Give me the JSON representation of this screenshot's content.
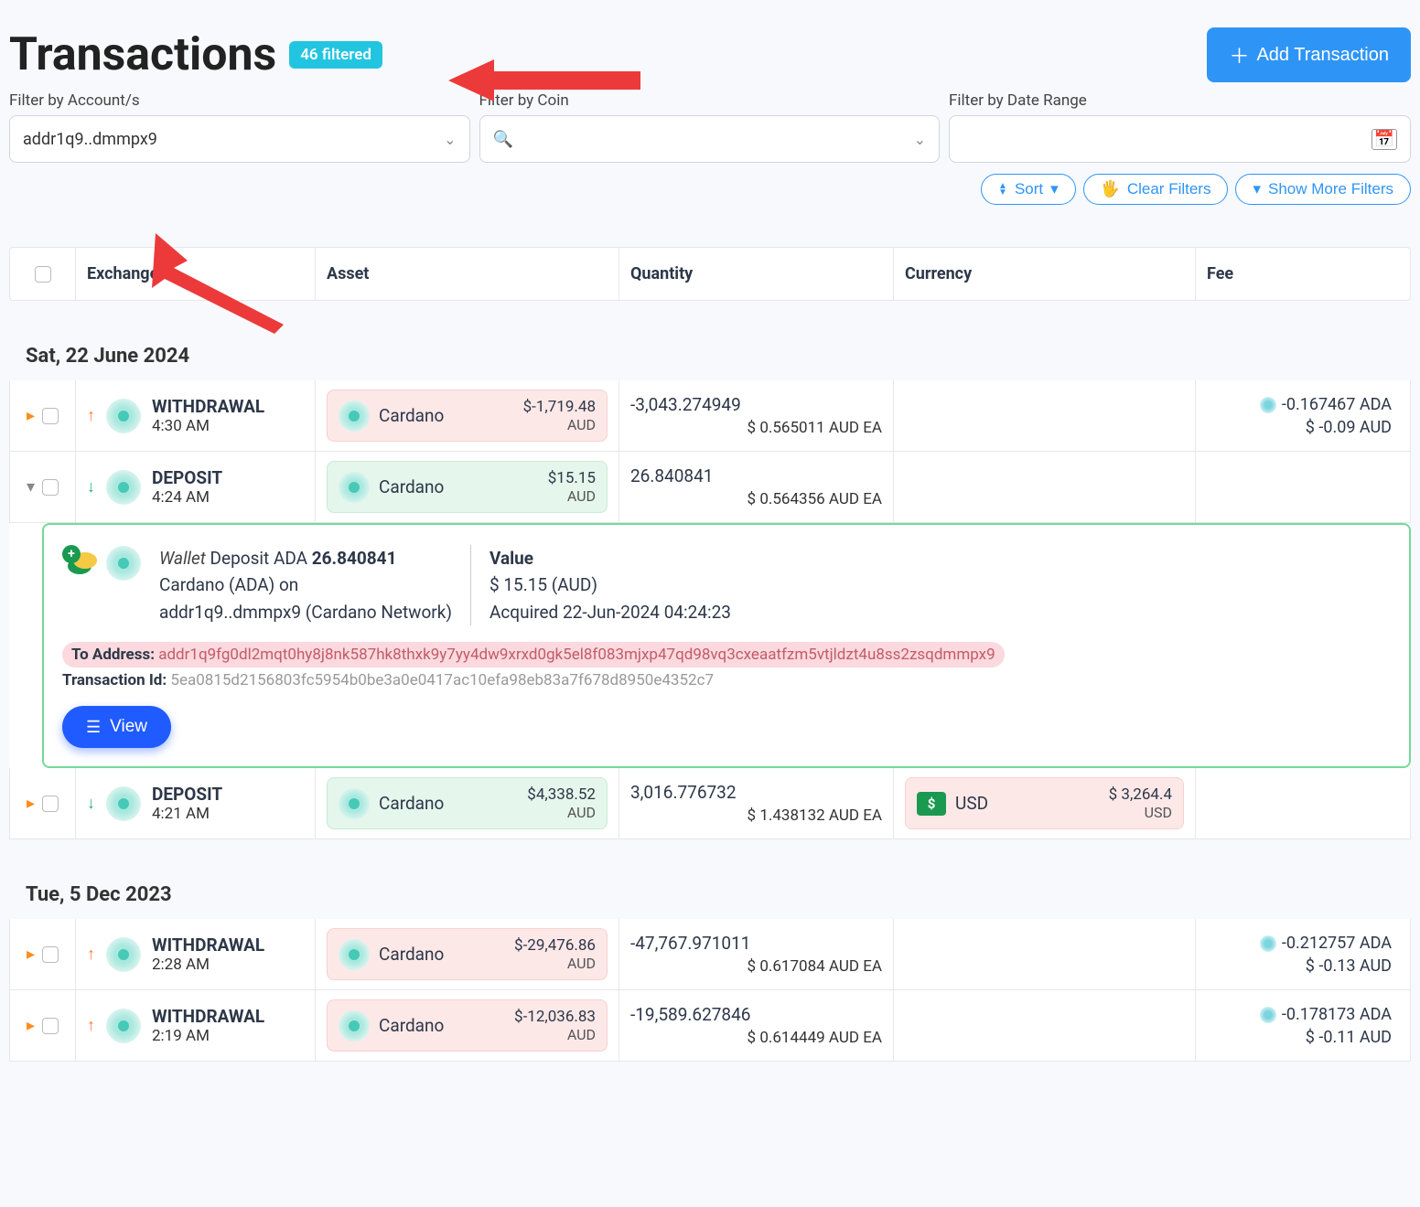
{
  "header": {
    "title": "Transactions",
    "filter_badge": "46 filtered",
    "add_button": "Add Transaction"
  },
  "filters": {
    "account_label": "Filter by Account/s",
    "account_value": "addr1q9..dmmpx9",
    "coin_label": "Filter by Coin",
    "date_label": "Filter by Date Range",
    "sort": "Sort",
    "clear": "Clear Filters",
    "show_more": "Show More Filters"
  },
  "columns": {
    "exchange": "Exchange",
    "asset": "Asset",
    "quantity": "Quantity",
    "currency": "Currency",
    "fee": "Fee"
  },
  "groups": [
    {
      "date": "Sat, 22 June 2024",
      "rows": [
        {
          "expanded": false,
          "caret": "orange",
          "dir": "up",
          "type": "WITHDRAWAL",
          "time": "4:30 AM",
          "asset_color": "red",
          "asset_name": "Cardano",
          "asset_val": "$-1,719.48",
          "asset_curr": "AUD",
          "qty": "-3,043.274949",
          "qty_sub": "$ 0.565011 AUD EA",
          "currency": null,
          "fee1": "-0.167467 ADA",
          "fee2": "$ -0.09 AUD"
        },
        {
          "expanded": true,
          "caret": "gray",
          "dir": "down",
          "type": "DEPOSIT",
          "time": "4:24 AM",
          "asset_color": "green",
          "asset_name": "Cardano",
          "asset_val": "$15.15",
          "asset_curr": "AUD",
          "qty": "26.840841",
          "qty_sub": "$ 0.564356 AUD EA",
          "currency": null,
          "fee1": null,
          "fee2": null,
          "detail": {
            "line1_prefix": "Wallet",
            "line1_mid": " Deposit ADA ",
            "line1_bold": "26.840841",
            "line2": "Cardano (ADA) on",
            "line3": "addr1q9..dmmpx9 (Cardano Network)",
            "value_label": "Value",
            "value_amount": "$ 15.15 (AUD)",
            "acquired": "Acquired 22-Jun-2024 04:24:23",
            "to_addr_label": "To Address:",
            "to_addr": "addr1q9fg0dl2mqt0hy8j8nk587hk8thxk9y7yy4dw9xrxd0gk5el8f083mjxp47qd98vq3cxeaatfzm5vtjldzt4u8ss2zsqdmmpx9",
            "txid_label": "Transaction Id:",
            "txid": "5ea0815d2156803fc5954b0be3a0e0417ac10efa98eb83a7f678d8950e4352c7",
            "view": "View"
          }
        },
        {
          "expanded": false,
          "caret": "orange",
          "dir": "down",
          "type": "DEPOSIT",
          "time": "4:21 AM",
          "asset_color": "green",
          "asset_name": "Cardano",
          "asset_val": "$4,338.52",
          "asset_curr": "AUD",
          "qty": "3,016.776732",
          "qty_sub": "$ 1.438132 AUD EA",
          "currency": {
            "name": "USD",
            "val": "$ 3,264.4",
            "curr": "USD"
          },
          "fee1": null,
          "fee2": null
        }
      ]
    },
    {
      "date": "Tue, 5 Dec 2023",
      "rows": [
        {
          "expanded": false,
          "caret": "orange",
          "dir": "up",
          "type": "WITHDRAWAL",
          "time": "2:28 AM",
          "asset_color": "red",
          "asset_name": "Cardano",
          "asset_val": "$-29,476.86",
          "asset_curr": "AUD",
          "qty": "-47,767.971011",
          "qty_sub": "$ 0.617084 AUD EA",
          "currency": null,
          "fee1": "-0.212757 ADA",
          "fee2": "$ -0.13 AUD"
        },
        {
          "expanded": false,
          "caret": "orange",
          "dir": "up",
          "type": "WITHDRAWAL",
          "time": "2:19 AM",
          "asset_color": "red",
          "asset_name": "Cardano",
          "asset_val": "$-12,036.83",
          "asset_curr": "AUD",
          "qty": "-19,589.627846",
          "qty_sub": "$ 0.614449 AUD EA",
          "currency": null,
          "fee1": "-0.178173 ADA",
          "fee2": "$ -0.11 AUD"
        }
      ]
    }
  ]
}
